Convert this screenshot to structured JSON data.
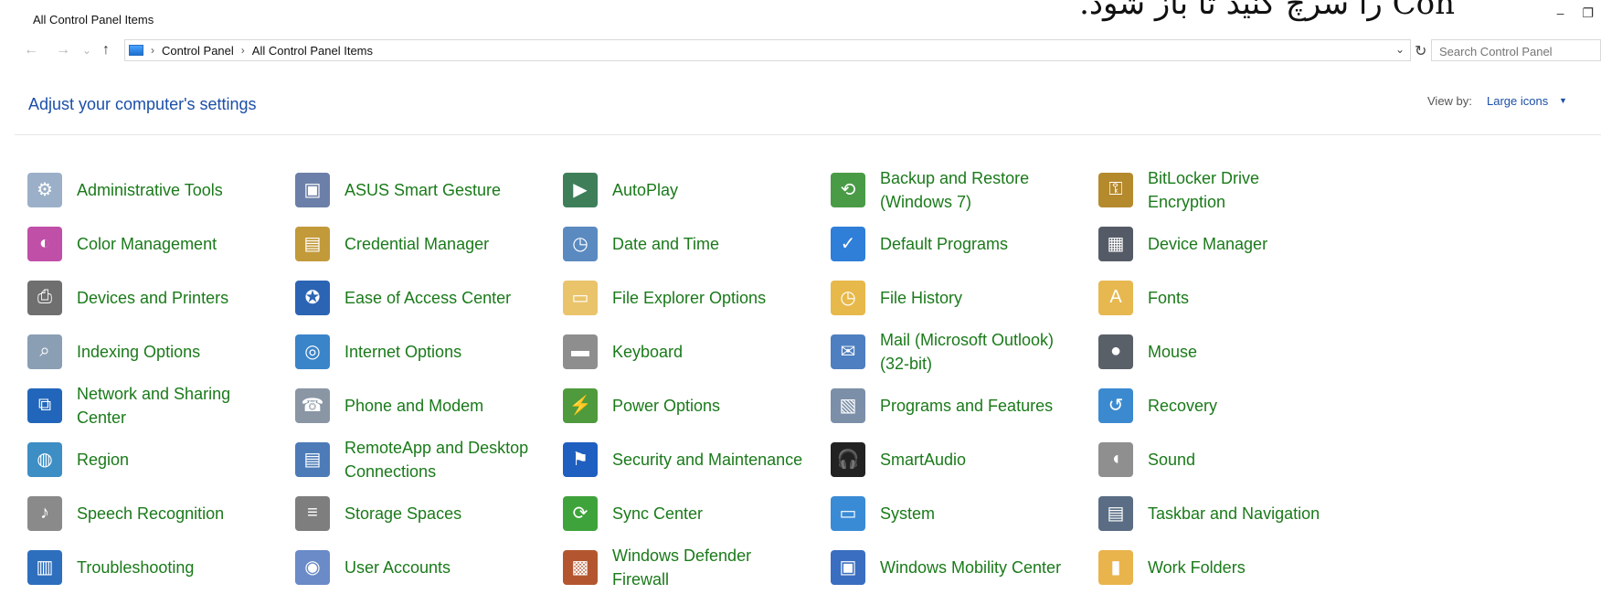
{
  "window": {
    "title": "All Control Panel Items",
    "overlay_text": "Con را سرچ کنید تا باز شود."
  },
  "nav": {
    "back": "←",
    "forward": "→",
    "recent": "⌄",
    "up": "↑",
    "refresh": "↻",
    "breadcrumb": [
      "Control Panel",
      "All Control Panel Items"
    ],
    "search_placeholder": "Search Control Panel"
  },
  "header": {
    "title": "Adjust your computer's settings",
    "view_by_label": "View by:",
    "view_by_value": "Large icons"
  },
  "colors": {
    "item_text": "#1a7a1a",
    "link_blue": "#1b4fa8"
  },
  "items": [
    {
      "label": "Administrative Tools",
      "icon": "admin-tools-icon"
    },
    {
      "label": "ASUS Smart Gesture",
      "icon": "touchpad-icon"
    },
    {
      "label": "AutoPlay",
      "icon": "autoplay-icon"
    },
    {
      "label": "Backup and Restore (Windows 7)",
      "icon": "backup-icon"
    },
    {
      "label": "BitLocker Drive Encryption",
      "icon": "bitlocker-icon"
    },
    {
      "label": "Color Management",
      "icon": "color-management-icon"
    },
    {
      "label": "Credential Manager",
      "icon": "credential-icon"
    },
    {
      "label": "Date and Time",
      "icon": "clock-icon"
    },
    {
      "label": "Default Programs",
      "icon": "default-programs-icon"
    },
    {
      "label": "Device Manager",
      "icon": "device-manager-icon"
    },
    {
      "label": "Devices and Printers",
      "icon": "printer-icon"
    },
    {
      "label": "Ease of Access Center",
      "icon": "ease-of-access-icon"
    },
    {
      "label": "File Explorer Options",
      "icon": "folder-options-icon"
    },
    {
      "label": "File History",
      "icon": "file-history-icon"
    },
    {
      "label": "Fonts",
      "icon": "fonts-icon"
    },
    {
      "label": "Indexing Options",
      "icon": "indexing-icon"
    },
    {
      "label": "Internet Options",
      "icon": "internet-options-icon"
    },
    {
      "label": "Keyboard",
      "icon": "keyboard-icon"
    },
    {
      "label": "Mail (Microsoft Outlook) (32-bit)",
      "icon": "mail-icon"
    },
    {
      "label": "Mouse",
      "icon": "mouse-icon"
    },
    {
      "label": "Network and Sharing Center",
      "icon": "network-icon"
    },
    {
      "label": "Phone and Modem",
      "icon": "phone-icon"
    },
    {
      "label": "Power Options",
      "icon": "power-icon"
    },
    {
      "label": "Programs and Features",
      "icon": "programs-icon"
    },
    {
      "label": "Recovery",
      "icon": "recovery-icon"
    },
    {
      "label": "Region",
      "icon": "region-icon"
    },
    {
      "label": "RemoteApp and Desktop Connections",
      "icon": "remoteapp-icon"
    },
    {
      "label": "Security and Maintenance",
      "icon": "flag-icon"
    },
    {
      "label": "SmartAudio",
      "icon": "headphones-icon"
    },
    {
      "label": "Sound",
      "icon": "speaker-icon"
    },
    {
      "label": "Speech Recognition",
      "icon": "microphone-icon"
    },
    {
      "label": "Storage Spaces",
      "icon": "storage-icon"
    },
    {
      "label": "Sync Center",
      "icon": "sync-icon"
    },
    {
      "label": "System",
      "icon": "system-icon"
    },
    {
      "label": "Taskbar and Navigation",
      "icon": "taskbar-icon"
    },
    {
      "label": "Troubleshooting",
      "icon": "troubleshooting-icon"
    },
    {
      "label": "User Accounts",
      "icon": "users-icon"
    },
    {
      "label": "Windows Defender Firewall",
      "icon": "firewall-icon"
    },
    {
      "label": "Windows Mobility Center",
      "icon": "mobility-icon"
    },
    {
      "label": "Work Folders",
      "icon": "work-folders-icon"
    }
  ]
}
